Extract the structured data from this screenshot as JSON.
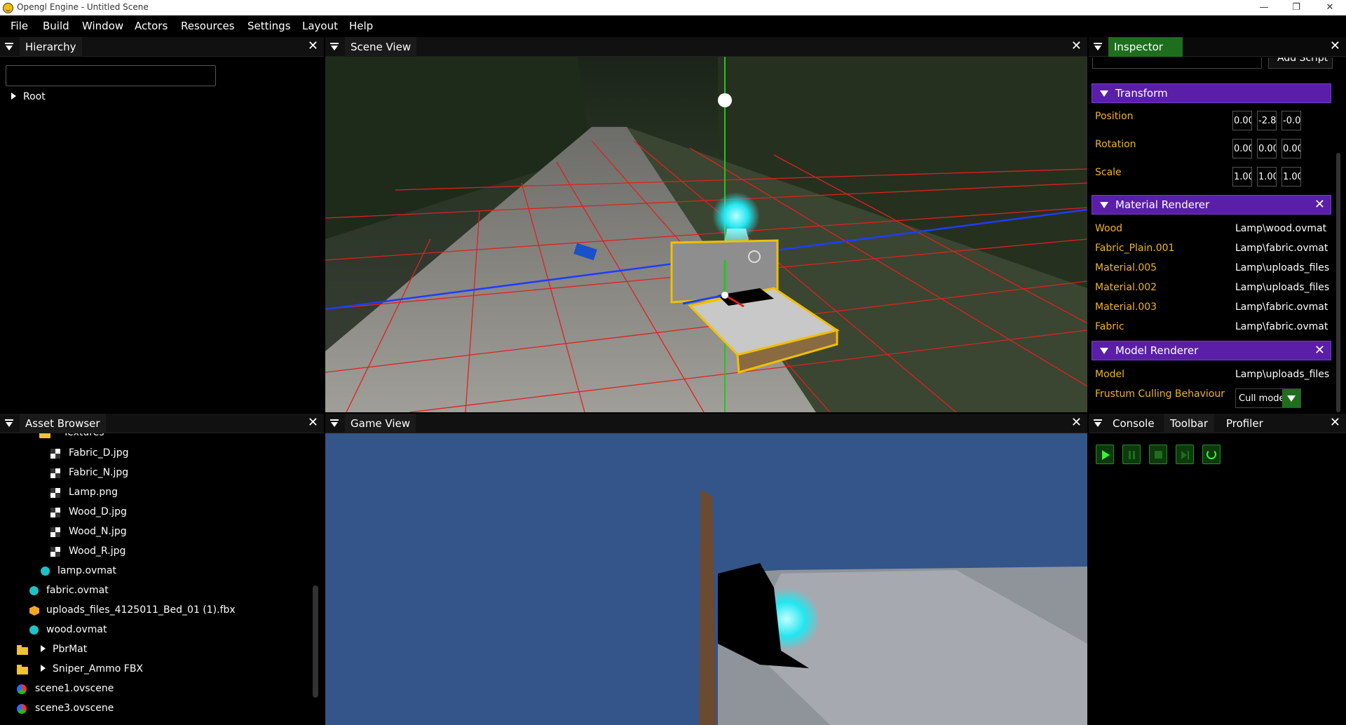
{
  "window": {
    "title": "Opengl Engine - Untitled Scene",
    "minimize_glyph": "—",
    "maximize_glyph": "❐",
    "close_glyph": "✕"
  },
  "menu": [
    "File",
    "Build",
    "Window",
    "Actors",
    "Resources",
    "Settings",
    "Layout",
    "Help"
  ],
  "panel_close_glyph": "✕",
  "hierarchy": {
    "title": "Hierarchy",
    "search_value": "",
    "root_label": "Root"
  },
  "scene_view": {
    "title": "Scene View"
  },
  "game_view": {
    "title": "Game View"
  },
  "asset_browser": {
    "title": "Asset Browser",
    "items": [
      {
        "label": "Textures",
        "icon": "folder-icon"
      },
      {
        "label": "Fabric_D.jpg",
        "icon": "texture-icon"
      },
      {
        "label": "Fabric_N.jpg",
        "icon": "texture-icon"
      },
      {
        "label": "Lamp.png",
        "icon": "texture-icon"
      },
      {
        "label": "Wood_D.jpg",
        "icon": "texture-icon"
      },
      {
        "label": "Wood_N.jpg",
        "icon": "texture-icon"
      },
      {
        "label": "Wood_R.jpg",
        "icon": "texture-icon"
      },
      {
        "label": "lamp.ovmat",
        "icon": "material-icon"
      },
      {
        "label": "fabric.ovmat",
        "icon": "material-icon"
      },
      {
        "label": "uploads_files_4125011_Bed_01 (1).fbx",
        "icon": "model-icon"
      },
      {
        "label": "wood.ovmat",
        "icon": "material-icon"
      },
      {
        "label": "PbrMat",
        "icon": "folder-icon"
      },
      {
        "label": "Sniper_Ammo FBX",
        "icon": "folder-icon"
      },
      {
        "label": "scene1.ovscene",
        "icon": "scene-icon"
      },
      {
        "label": "scene3.ovscene",
        "icon": "scene-icon"
      }
    ]
  },
  "inspector": {
    "title": "Inspector",
    "add_script_label": "Add Script",
    "transform": {
      "title": "Transform",
      "position_label": "Position",
      "rotation_label": "Rotation",
      "scale_label": "Scale",
      "position": [
        "0.00",
        "-2.8",
        "-0.0"
      ],
      "rotation": [
        "0.00",
        "0.00",
        "0.00"
      ],
      "scale": [
        "1.00",
        "1.00",
        "1.00"
      ]
    },
    "material_renderer": {
      "title": "Material Renderer",
      "rows": [
        {
          "label": "Wood",
          "value": "Lamp\\wood.ovmat"
        },
        {
          "label": "Fabric_Plain.001",
          "value": "Lamp\\fabric.ovmat"
        },
        {
          "label": "Material.005",
          "value": "Lamp\\uploads_files"
        },
        {
          "label": "Material.002",
          "value": "Lamp\\uploads_files"
        },
        {
          "label": "Material.003",
          "value": "Lamp\\fabric.ovmat"
        },
        {
          "label": "Fabric",
          "value": "Lamp\\fabric.ovmat"
        }
      ]
    },
    "model_renderer": {
      "title": "Model Renderer",
      "model_label": "Model",
      "model_value": "Lamp\\uploads_files",
      "culling_label": "Frustum Culling Behaviour",
      "culling_value": "Cull model"
    }
  },
  "bottom_tabs": [
    "Console",
    "Toolbar",
    "Profiler"
  ],
  "colors": {
    "accent_purple": "#5a1ea8",
    "inspector_tab_green": "#1e6e1e",
    "label_orange": "#f0b428",
    "game_sky": "#34558a"
  }
}
